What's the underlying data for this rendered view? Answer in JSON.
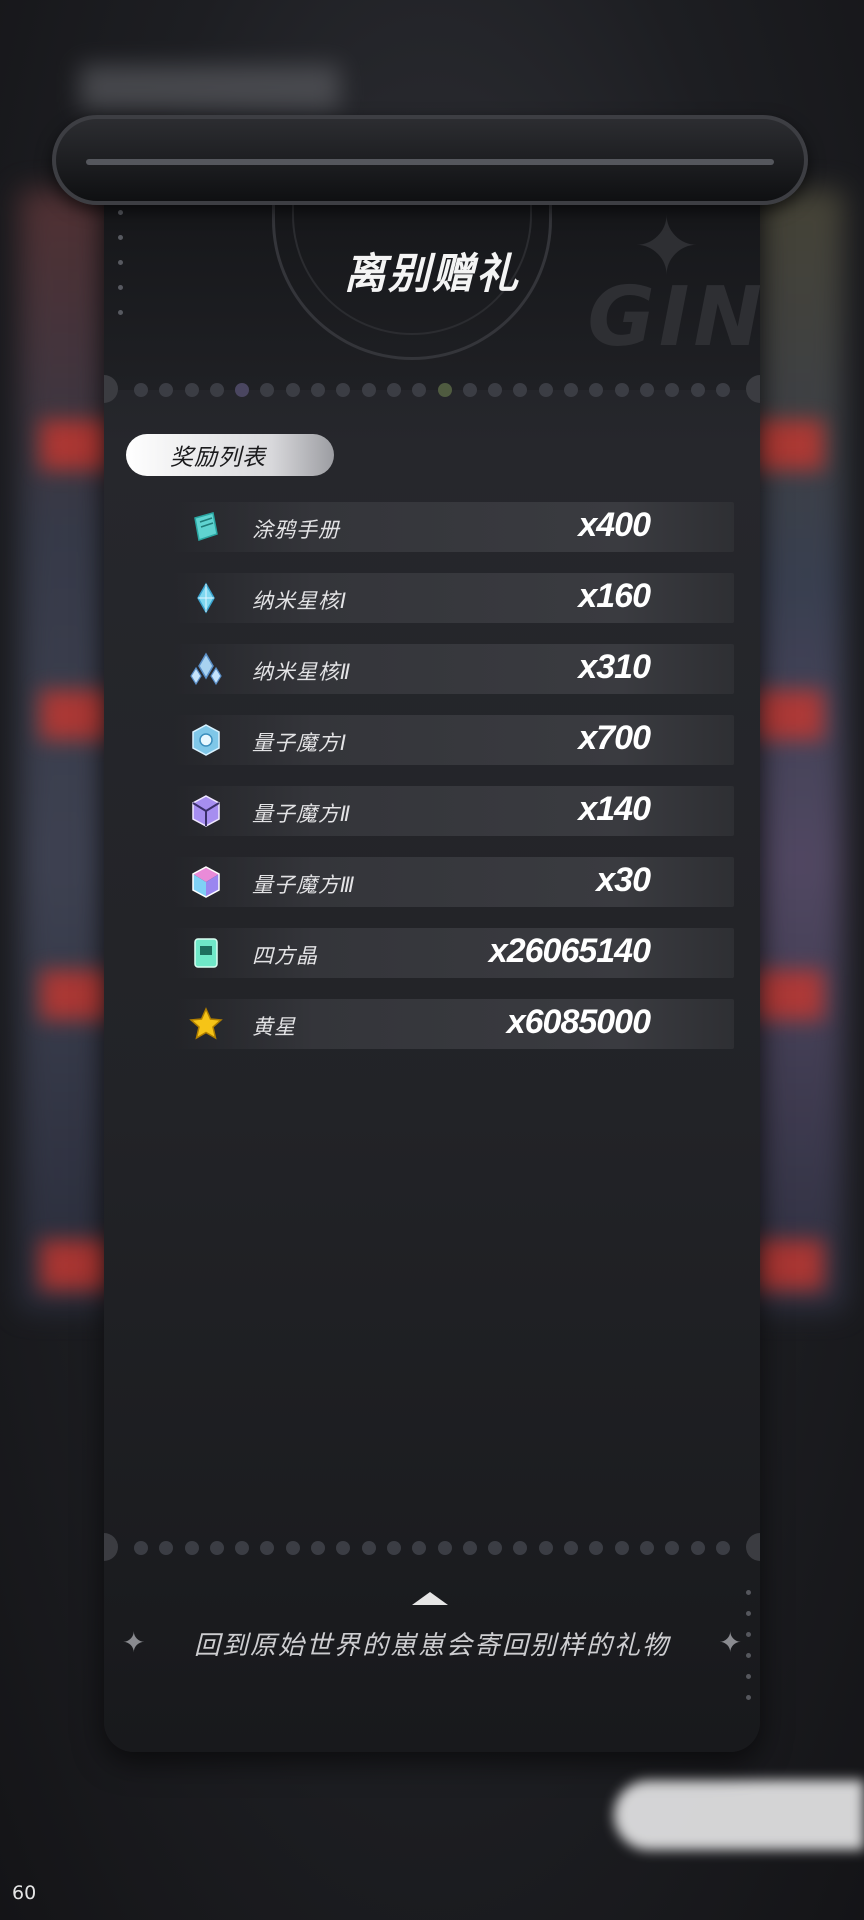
{
  "title": "离别赠礼",
  "section_label": "奖励列表",
  "rewards": [
    {
      "name": "涂鸦手册",
      "qty": "x400",
      "icon": "notebook-icon",
      "color": "#5fd3d0"
    },
    {
      "name": "纳米星核Ⅰ",
      "qty": "x160",
      "icon": "crystal-icon",
      "color": "#7fd8f0"
    },
    {
      "name": "纳米星核Ⅱ",
      "qty": "x310",
      "icon": "crystal-cluster-icon",
      "color": "#a8d2f0"
    },
    {
      "name": "量子魔方Ⅰ",
      "qty": "x700",
      "icon": "cube-blue-icon",
      "color": "#7fc7e8"
    },
    {
      "name": "量子魔方Ⅱ",
      "qty": "x140",
      "icon": "cube-purple-icon",
      "color": "#a68ef0"
    },
    {
      "name": "量子魔方Ⅲ",
      "qty": "x30",
      "icon": "cube-rainbow-icon",
      "color": "#e98bd8"
    },
    {
      "name": "四方晶",
      "qty": "x26065140",
      "icon": "square-crystal-icon",
      "color": "#6fe8c8"
    },
    {
      "name": "黄星",
      "qty": "x6085000",
      "icon": "yellow-star-icon",
      "color": "#f6c417"
    }
  ],
  "footer_text": "回到原始世界的崽崽会寄回别样的礼物",
  "fps": "60"
}
